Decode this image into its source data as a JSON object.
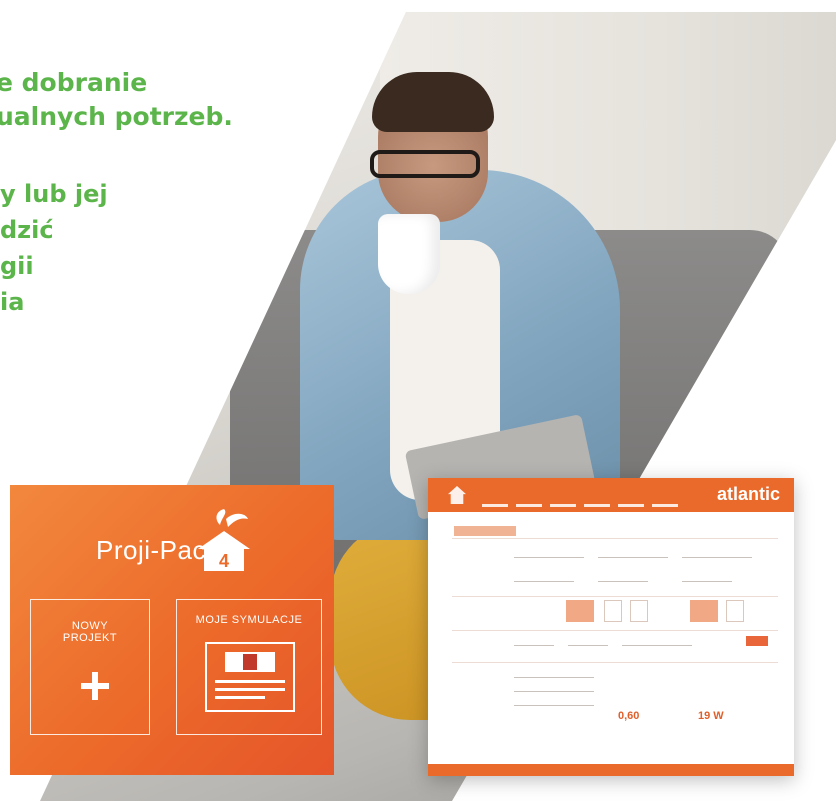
{
  "headline": {
    "line1": "e dobranie",
    "line2": "ualnych potrzeb."
  },
  "body_lines": [
    "y lub jej",
    "dzić",
    "gii",
    "ia"
  ],
  "colors": {
    "green_text": "#5bb54a",
    "orange_brand": "#ea6a2b"
  },
  "card": {
    "brand": "Proji-Pac",
    "badge_number": "4",
    "tiles": [
      {
        "label_line1": "NOWY",
        "label_line2": "PROJEKT",
        "icon": "plus-icon"
      },
      {
        "label_line1": "MOJE SYMULACJE",
        "label_line2": "",
        "icon": "document-icon"
      }
    ]
  },
  "app": {
    "logo": "atlantic",
    "values": [
      "0,60",
      "19 W"
    ]
  }
}
